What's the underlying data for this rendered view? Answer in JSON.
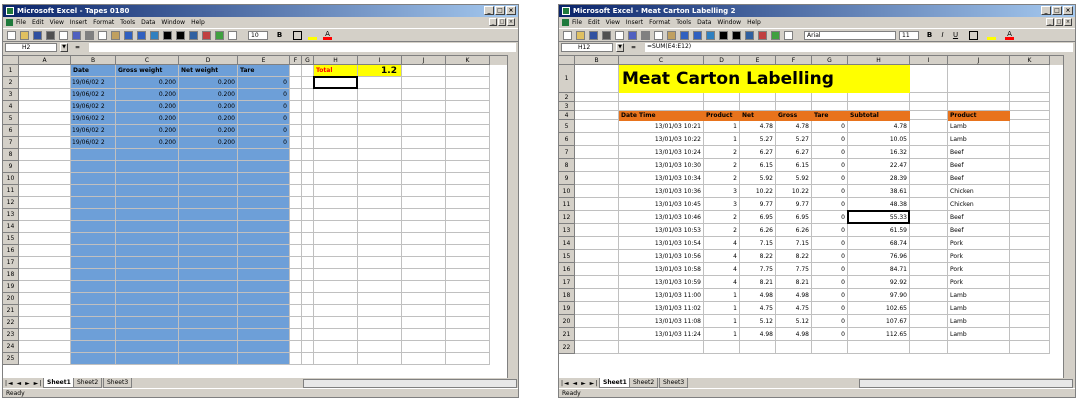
{
  "colors": {
    "title_bar": "#0a246a",
    "blue_fill": "#6d9fd8",
    "orange_header": "#e8731c",
    "yellow_title": "#ffff00",
    "total_fill": "#ffff00",
    "total_text": "#ff0000"
  },
  "left_window": {
    "title": "Microsoft Excel - Tapes 0180",
    "menu": [
      "File",
      "Edit",
      "View",
      "Insert",
      "Format",
      "Tools",
      "Data",
      "Window",
      "Help"
    ],
    "font_size": "10",
    "name_box": "H2",
    "formula": "",
    "columns": [
      "A",
      "B",
      "C",
      "D",
      "E",
      "F",
      "G",
      "H",
      "I",
      "J",
      "K"
    ],
    "rows": [
      "1",
      "2",
      "3",
      "4",
      "5",
      "6",
      "7",
      "8",
      "9",
      "10",
      "11",
      "12",
      "13",
      "14",
      "15",
      "16",
      "17",
      "18",
      "19",
      "20",
      "21",
      "22",
      "23",
      "24",
      "25"
    ],
    "headers": {
      "date": "Date",
      "gross": "Gross weight",
      "net": "Net weight",
      "tare": "Tare"
    },
    "data": [
      {
        "date": "19/06/02 2",
        "gross": "0.200",
        "net": "0.200",
        "tare": "0"
      },
      {
        "date": "19/06/02 2",
        "gross": "0.200",
        "net": "0.200",
        "tare": "0"
      },
      {
        "date": "19/06/02 2",
        "gross": "0.200",
        "net": "0.200",
        "tare": "0"
      },
      {
        "date": "19/06/02 2",
        "gross": "0.200",
        "net": "0.200",
        "tare": "0"
      },
      {
        "date": "19/06/02 2",
        "gross": "0.200",
        "net": "0.200",
        "tare": "0"
      },
      {
        "date": "19/06/02 2",
        "gross": "0.200",
        "net": "0.200",
        "tare": "0"
      }
    ],
    "total_label": "Total",
    "total_value": "1.2",
    "sheets": [
      "Sheet1",
      "Sheet2",
      "Sheet3"
    ],
    "status": "Ready"
  },
  "right_window": {
    "title": "Microsoft Excel - Meat Carton Labelling 2",
    "menu": [
      "File",
      "Edit",
      "View",
      "Insert",
      "Format",
      "Tools",
      "Data",
      "Window",
      "Help"
    ],
    "font_name": "Arial",
    "font_size": "11",
    "name_box": "H12",
    "formula": "=SUM(E4:E12)",
    "columns": [
      "B",
      "C",
      "D",
      "E",
      "F",
      "G",
      "H",
      "I",
      "J",
      "K"
    ],
    "rows": [
      "1",
      "2",
      "3",
      "4",
      "5",
      "6",
      "7",
      "8",
      "9",
      "10",
      "11",
      "12",
      "13",
      "14",
      "15",
      "16",
      "17",
      "18",
      "19",
      "20",
      "21",
      "22"
    ],
    "sheet_title": "Meat Carton Labelling",
    "headers": {
      "date": "Date Time",
      "product_no": "Product",
      "net": "Net",
      "gross": "Gross",
      "tare": "Tare",
      "subtotal": "Subtotal",
      "product": "Product"
    },
    "data": [
      {
        "date": "13/01/03 10:21",
        "pno": "1",
        "net": "4.78",
        "gross": "4.78",
        "tare": "0",
        "subtotal": "4.78",
        "product": "Lamb"
      },
      {
        "date": "13/01/03 10:22",
        "pno": "1",
        "net": "5.27",
        "gross": "5.27",
        "tare": "0",
        "subtotal": "10.05",
        "product": "Lamb"
      },
      {
        "date": "13/01/03 10:24",
        "pno": "2",
        "net": "6.27",
        "gross": "6.27",
        "tare": "0",
        "subtotal": "16.32",
        "product": "Beef"
      },
      {
        "date": "13/01/03 10:30",
        "pno": "2",
        "net": "6.15",
        "gross": "6.15",
        "tare": "0",
        "subtotal": "22.47",
        "product": "Beef"
      },
      {
        "date": "13/01/03 10:34",
        "pno": "2",
        "net": "5.92",
        "gross": "5.92",
        "tare": "0",
        "subtotal": "28.39",
        "product": "Beef"
      },
      {
        "date": "13/01/03 10:36",
        "pno": "3",
        "net": "10.22",
        "gross": "10.22",
        "tare": "0",
        "subtotal": "38.61",
        "product": "Chicken"
      },
      {
        "date": "13/01/03 10:45",
        "pno": "3",
        "net": "9.77",
        "gross": "9.77",
        "tare": "0",
        "subtotal": "48.38",
        "product": "Chicken"
      },
      {
        "date": "13/01/03 10:46",
        "pno": "2",
        "net": "6.95",
        "gross": "6.95",
        "tare": "0",
        "subtotal": "55.33",
        "product": "Beef"
      },
      {
        "date": "13/01/03 10:53",
        "pno": "2",
        "net": "6.26",
        "gross": "6.26",
        "tare": "0",
        "subtotal": "61.59",
        "product": "Beef"
      },
      {
        "date": "13/01/03 10:54",
        "pno": "4",
        "net": "7.15",
        "gross": "7.15",
        "tare": "0",
        "subtotal": "68.74",
        "product": "Pork"
      },
      {
        "date": "13/01/03 10:56",
        "pno": "4",
        "net": "8.22",
        "gross": "8.22",
        "tare": "0",
        "subtotal": "76.96",
        "product": "Pork"
      },
      {
        "date": "13/01/03 10:58",
        "pno": "4",
        "net": "7.75",
        "gross": "7.75",
        "tare": "0",
        "subtotal": "84.71",
        "product": "Pork"
      },
      {
        "date": "13/01/03 10:59",
        "pno": "4",
        "net": "8.21",
        "gross": "8.21",
        "tare": "0",
        "subtotal": "92.92",
        "product": "Pork"
      },
      {
        "date": "13/01/03 11:00",
        "pno": "1",
        "net": "4.98",
        "gross": "4.98",
        "tare": "0",
        "subtotal": "97.90",
        "product": "Lamb"
      },
      {
        "date": "13/01/03 11:02",
        "pno": "1",
        "net": "4.75",
        "gross": "4.75",
        "tare": "0",
        "subtotal": "102.65",
        "product": "Lamb"
      },
      {
        "date": "13/01/03 11:08",
        "pno": "1",
        "net": "5.12",
        "gross": "5.12",
        "tare": "0",
        "subtotal": "107.67",
        "product": "Lamb"
      },
      {
        "date": "13/01/03 11:24",
        "pno": "1",
        "net": "4.98",
        "gross": "4.98",
        "tare": "0",
        "subtotal": "112.65",
        "product": "Lamb"
      }
    ],
    "sheets": [
      "Sheet1",
      "Sheet2",
      "Sheet3"
    ],
    "status": "Ready"
  }
}
